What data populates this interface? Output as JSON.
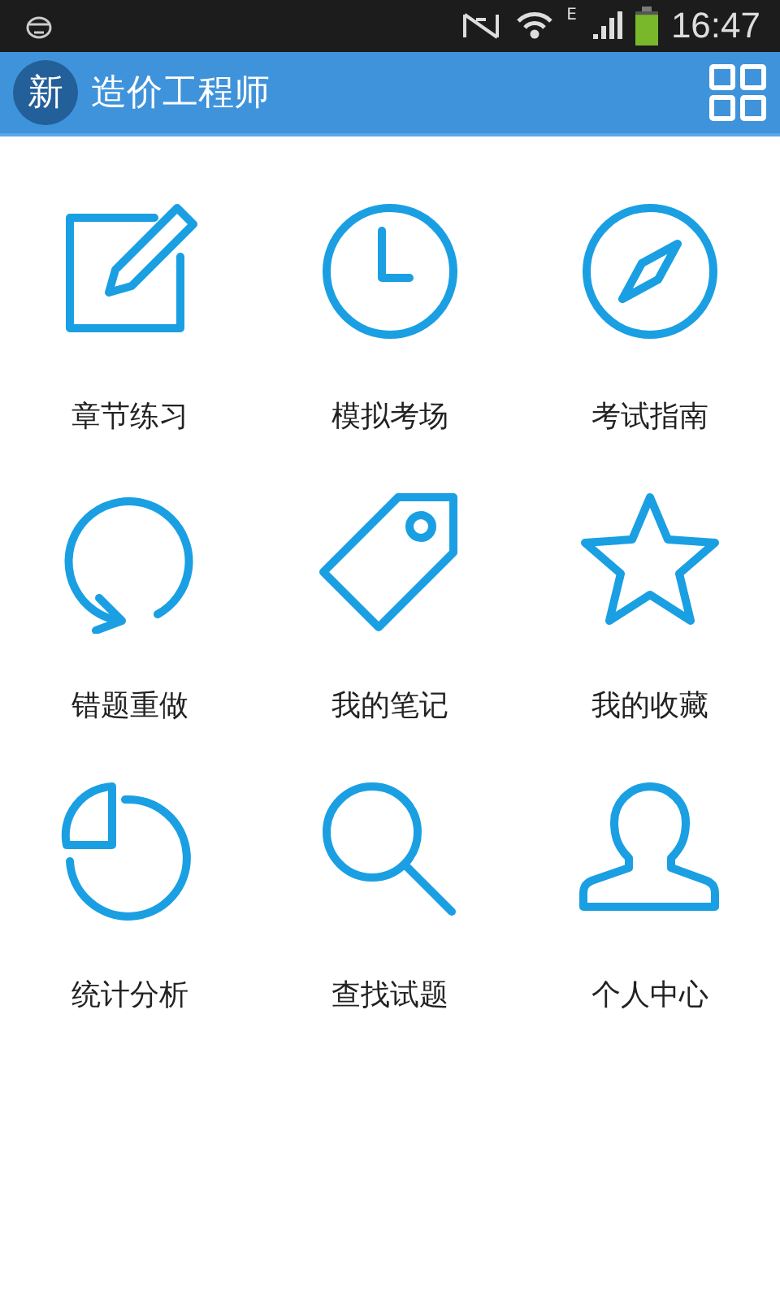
{
  "status_bar": {
    "network_type": "E",
    "time": "16:47"
  },
  "header": {
    "logo": "新",
    "title": "造价工程师"
  },
  "grid": [
    {
      "kind": "edit",
      "label": "章节练习"
    },
    {
      "kind": "clock",
      "label": "模拟考场"
    },
    {
      "kind": "compass",
      "label": "考试指南"
    },
    {
      "kind": "redo",
      "label": "错题重做"
    },
    {
      "kind": "tag",
      "label": "我的笔记"
    },
    {
      "kind": "star",
      "label": "我的收藏"
    },
    {
      "kind": "pie",
      "label": "统计分析"
    },
    {
      "kind": "search",
      "label": "查找试题"
    },
    {
      "kind": "user",
      "label": "个人中心"
    }
  ]
}
